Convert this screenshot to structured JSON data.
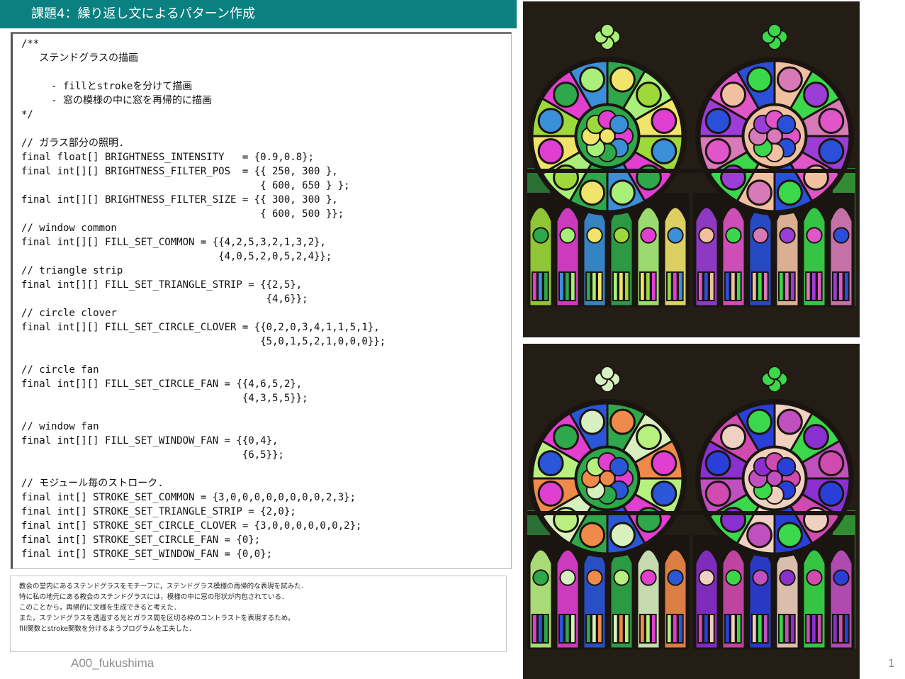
{
  "slide": {
    "title": "課題4：繰り返し文によるパターン作成",
    "author": "A00_fukushima",
    "page_number": "1"
  },
  "code": {
    "lines": [
      "/**",
      "   ステンドグラスの描画",
      "",
      "     - fillとstrokeを分けて描画",
      "     - 窓の模様の中に窓を再帰的に描画",
      "*/",
      "",
      "// ガラス部分の照明.",
      "final float[] BRIGHTNESS_INTENSITY   = {0.9,0.8};",
      "final int[][] BRIGHTNESS_FILTER_POS  = {{ 250, 300 },",
      "                                        { 600, 650 } };",
      "final int[][] BRIGHTNESS_FILTER_SIZE = {{ 300, 300 },",
      "                                        { 600, 500 }};",
      "// window common",
      "final int[][] FILL_SET_COMMON = {{4,2,5,3,2,1,3,2},",
      "                                 {4,0,5,2,0,5,2,4}};",
      "// triangle strip",
      "final int[][] FILL_SET_TRIANGLE_STRIP = {{2,5},",
      "                                         {4,6}};",
      "// circle clover",
      "final int[][] FILL_SET_CIRCLE_CLOVER = {{0,2,0,3,4,1,1,5,1},",
      "                                        {5,0,1,5,2,1,0,0,0}};",
      "",
      "// circle fan",
      "final int[][] FILL_SET_CIRCLE_FAN = {{4,6,5,2},",
      "                                     {4,3,5,5}};",
      "",
      "// window fan",
      "final int[][] FILL_SET_WINDOW_FAN = {{0,4},",
      "                                     {6,5}};",
      "",
      "// モジュール毎のストローク.",
      "final int[] STROKE_SET_COMMON = {3,0,0,0,0,0,0,0,0,2,3};",
      "final int[] STROKE_SET_TRIANGLE_STRIP = {2,0};",
      "final int[] STROKE_SET_CIRCLE_CLOVER = {3,0,0,0,0,0,0,2};",
      "final int[] STROKE_SET_CIRCLE_FAN = {0};",
      "final int[] STROKE_SET_WINDOW_FAN = {0,0};"
    ]
  },
  "description": {
    "lines": [
      "教会の堂内にあるステンドグラスをモチーフに，ステンドグラス模様の再帰的な表現を試みた．",
      "特に私の地元にある教会のステンドグラスには，模様の中に窓の形状が内包されている．",
      "このことから，再帰的に文様を生成できると考えた．",
      "また，ステンドグラスを透過する光とガラス間を区切る枠のコントラストを表現するため，",
      "fill関数とstroke関数を分けるようプログラムを工夫した．"
    ]
  },
  "images": [
    {
      "name": "stained-glass-output-1",
      "background": "#231d16",
      "left_window": [
        "#9dd93a",
        "#e03fd0",
        "#3a8fd8",
        "#2ea84a",
        "#a8f07a",
        "#f0e56a"
      ],
      "right_window": [
        "#9b3dd6",
        "#e055c8",
        "#2a4fd8",
        "#f0c0a0",
        "#3ad84a",
        "#d87ab8"
      ]
    },
    {
      "name": "stained-glass-output-2",
      "background": "#231d16",
      "left_window": [
        "#b8f080",
        "#e03fd0",
        "#2a56d8",
        "#2ea84a",
        "#d8f0c0",
        "#f08a4a"
      ],
      "right_window": [
        "#8a2fd0",
        "#d04ab0",
        "#2a3fd8",
        "#f0d0c0",
        "#3ad84a",
        "#c050c0"
      ]
    }
  ]
}
